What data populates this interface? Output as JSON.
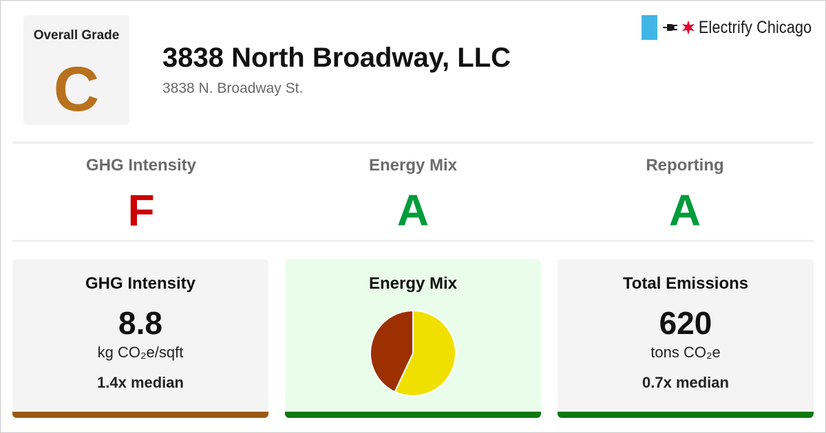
{
  "overall": {
    "label": "Overall Grade",
    "grade": "C",
    "grade_color": "#b8711d"
  },
  "building": {
    "name": "3838 North Broadway, LLC",
    "address": "3838 N. Broadway St."
  },
  "logo": {
    "text": "Electrify Chicago",
    "flag_color": "#41b6e6",
    "star_color": "#e4002b",
    "icons": [
      "plug-icon",
      "chicago-star-icon"
    ]
  },
  "subgrades": [
    {
      "label": "GHG Intensity",
      "grade": "F",
      "color": "#cc0000"
    },
    {
      "label": "Energy Mix",
      "grade": "A",
      "color": "#009c3b"
    },
    {
      "label": "Reporting",
      "grade": "A",
      "color": "#009c3b"
    }
  ],
  "cards": {
    "ghg": {
      "title": "GHG Intensity",
      "value": "8.8",
      "unit": "kg CO₂e/sqft",
      "median": "1.4x median",
      "bar_color": "#9b5a0f"
    },
    "energy_mix": {
      "title": "Energy Mix",
      "bar_color": "#0d7a0d"
    },
    "emissions": {
      "title": "Total Emissions",
      "value": "620",
      "unit": "tons CO₂e",
      "median": "0.7x median",
      "bar_color": "#0d7a0d"
    }
  },
  "chart_data": {
    "type": "pie",
    "title": "",
    "slices": [
      {
        "value": 0.57,
        "color": "#f0e000"
      },
      {
        "value": 0.43,
        "color": "#9c3000"
      }
    ]
  }
}
